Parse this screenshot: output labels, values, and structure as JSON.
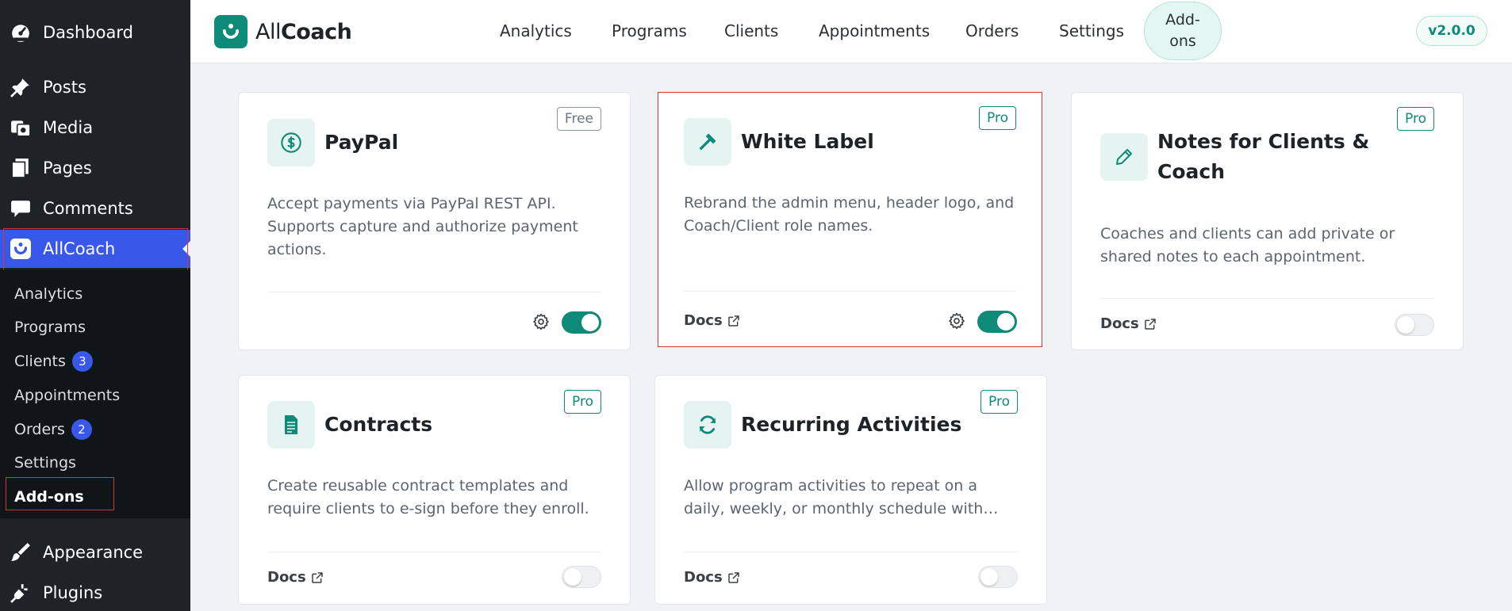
{
  "wp_menu": {
    "items": [
      {
        "label": "Dashboard",
        "icon": "dashboard-icon"
      },
      {
        "label": "Posts",
        "icon": "pin-icon"
      },
      {
        "label": "Media",
        "icon": "media-icon"
      },
      {
        "label": "Pages",
        "icon": "pages-icon"
      },
      {
        "label": "Comments",
        "icon": "comment-icon"
      },
      {
        "label": "AllCoach",
        "icon": "allcoach-icon"
      },
      {
        "label": "Appearance",
        "icon": "brush-icon"
      },
      {
        "label": "Plugins",
        "icon": "plug-icon"
      }
    ],
    "submenu": [
      {
        "label": "Analytics"
      },
      {
        "label": "Programs"
      },
      {
        "label": "Clients",
        "count": "3"
      },
      {
        "label": "Appointments"
      },
      {
        "label": "Orders",
        "count": "2"
      },
      {
        "label": "Settings"
      },
      {
        "label": "Add-ons"
      }
    ]
  },
  "header": {
    "logo_light": "All",
    "logo_bold": "Coach",
    "nav": [
      "Analytics",
      "Programs",
      "Clients",
      "Appointments",
      "Orders",
      "Settings"
    ],
    "active_nav": "Add-ons",
    "version": "v2.0.0"
  },
  "addons": [
    {
      "title": "PayPal",
      "badge": "Free",
      "icon": "dollar-icon",
      "description": "Accept payments via PayPal REST API. Supports capture and authorize payment actions.",
      "docs": "",
      "enabled": true
    },
    {
      "title": "White Label",
      "badge": "Pro",
      "icon": "hammer-icon",
      "description": "Rebrand the admin menu, header logo, and Coach/Client role names.",
      "docs": "Docs",
      "enabled": true
    },
    {
      "title": "Notes for Clients & Coach",
      "badge": "Pro",
      "icon": "pencil-icon",
      "description": "Coaches and clients can add private or shared notes to each appointment.",
      "docs": "Docs",
      "enabled": false
    },
    {
      "title": "Contracts",
      "badge": "Pro",
      "icon": "document-icon",
      "description": "Create reusable contract templates and require clients to e-sign before they enroll.",
      "docs": "Docs",
      "enabled": false
    },
    {
      "title": "Recurring Activities",
      "badge": "Pro",
      "icon": "refresh-icon",
      "description": "Allow program activities to repeat on a daily, weekly, or monthly schedule with custom end dates.",
      "docs": "Docs",
      "enabled": false
    }
  ],
  "colors": {
    "accent": "#0e8a78",
    "wp_active": "#3858e9",
    "highlight": "#d63638"
  }
}
